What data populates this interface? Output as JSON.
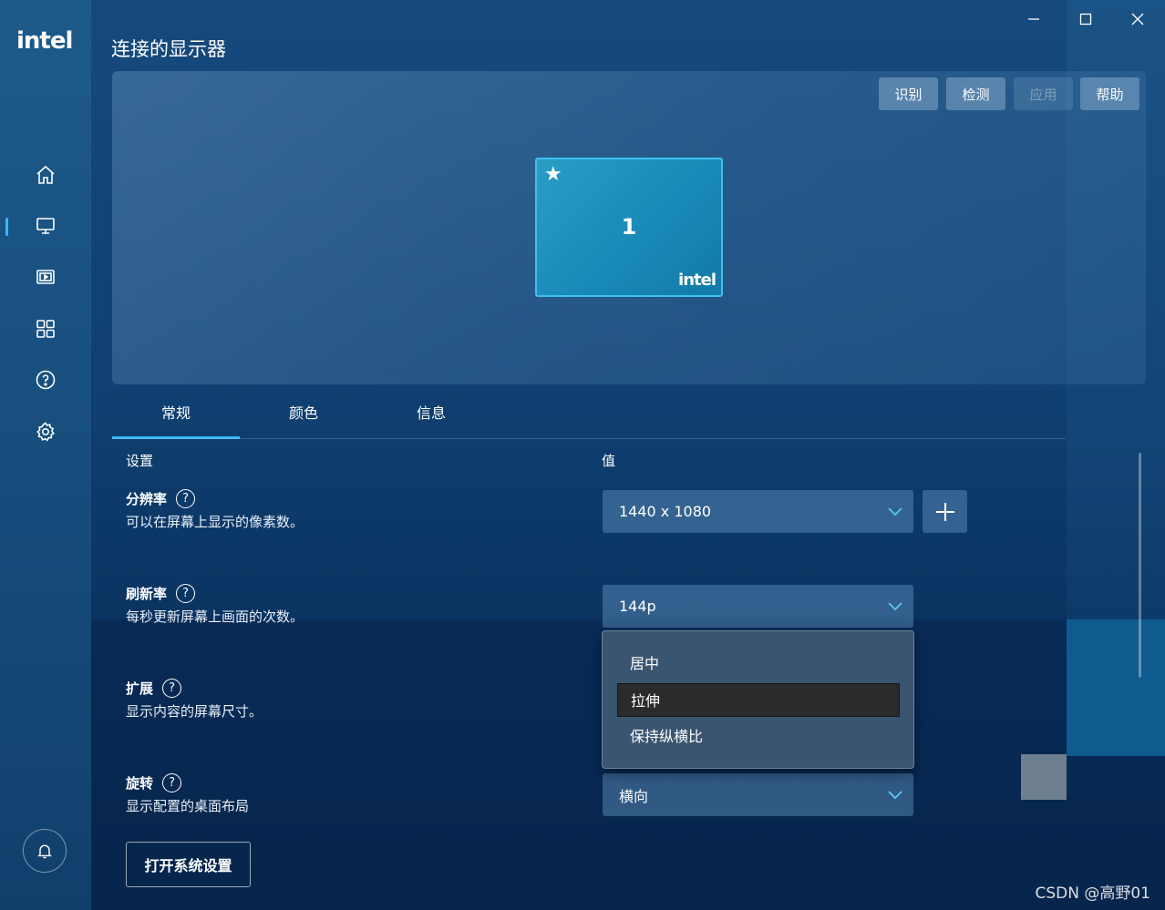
{
  "sidebar": {
    "logo": "intel",
    "items": [
      {
        "name": "home-icon"
      },
      {
        "name": "display-icon"
      },
      {
        "name": "video-icon"
      },
      {
        "name": "apps-grid-icon"
      },
      {
        "name": "help-icon"
      },
      {
        "name": "gear-icon"
      }
    ],
    "active_item": "display-icon",
    "bell_icon": "bell-icon"
  },
  "window": {
    "title": "连接的显示器",
    "controls": [
      "minimize",
      "maximize",
      "close"
    ]
  },
  "toolbar": {
    "identify": "识别",
    "detect": "检测",
    "apply": "应用",
    "help": "帮助"
  },
  "display": {
    "number": "1",
    "logo": "intel",
    "primary_star": "★"
  },
  "tabs": {
    "general": "常规",
    "color": "颜色",
    "info": "信息",
    "active": "常规"
  },
  "columns": {
    "setting": "设置",
    "value": "值"
  },
  "settings": {
    "resolution": {
      "title": "分辨率",
      "desc": "可以在屏幕上显示的像素数。",
      "value": "1440 x 1080"
    },
    "refresh": {
      "title": "刷新率",
      "desc": "每秒更新屏幕上画面的次数。",
      "value": "144p"
    },
    "scale": {
      "title": "扩展",
      "desc": "显示内容的屏幕尺寸。",
      "options": [
        "居中",
        "拉伸",
        "保持纵横比"
      ],
      "selected": "拉伸"
    },
    "rotation": {
      "title": "旋转",
      "desc": "显示配置的桌面布局",
      "value": "横向"
    }
  },
  "buttons": {
    "open_system_settings": "打开系统设置"
  },
  "watermark": "CSDN @高野01",
  "colors": {
    "accent": "#3ab5ef",
    "background": "#0f3f70"
  }
}
